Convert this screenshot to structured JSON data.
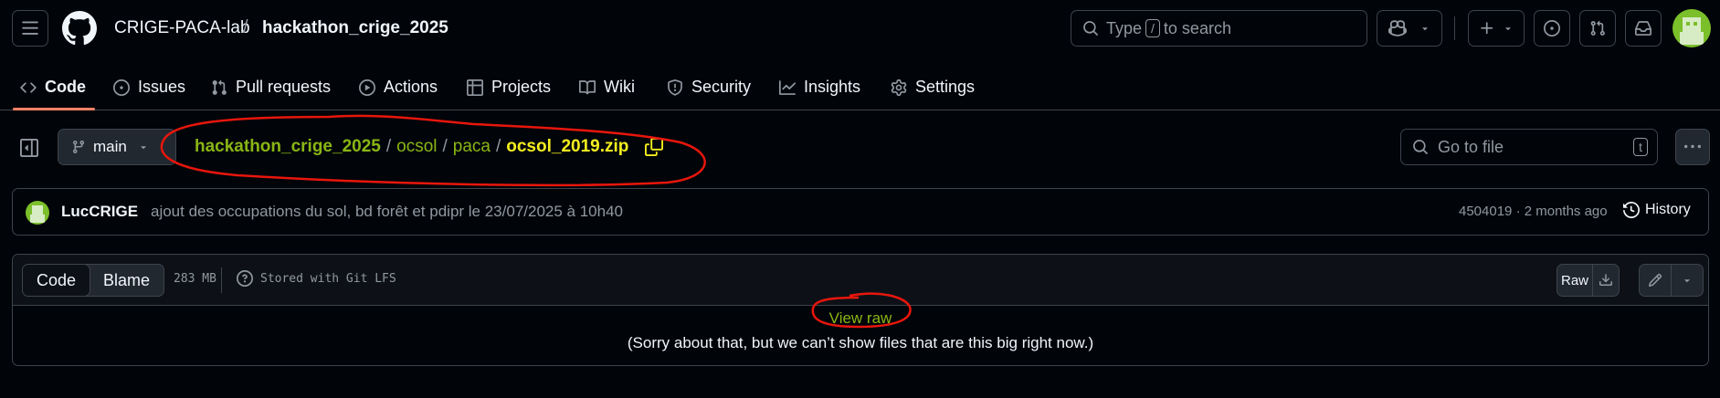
{
  "header": {
    "owner": "CRIGE-PACA-lab",
    "separator": "/",
    "repo": "hackathon_crige_2025",
    "search_prefix": "Type",
    "search_key": "/",
    "search_suffix": "to search"
  },
  "tabs": [
    {
      "label": "Code",
      "icon": "code-icon",
      "active": true
    },
    {
      "label": "Issues",
      "icon": "issue-icon"
    },
    {
      "label": "Pull requests",
      "icon": "pull-request-icon"
    },
    {
      "label": "Actions",
      "icon": "play-icon"
    },
    {
      "label": "Projects",
      "icon": "table-icon"
    },
    {
      "label": "Wiki",
      "icon": "book-icon"
    },
    {
      "label": "Security",
      "icon": "shield-icon"
    },
    {
      "label": "Insights",
      "icon": "graph-icon"
    },
    {
      "label": "Settings",
      "icon": "gear-icon"
    }
  ],
  "filebar": {
    "branch": "main",
    "breadcrumb": {
      "root": "hackathon_crige_2025",
      "sep": "/",
      "dir1": "ocsol",
      "dir2": "paca",
      "file": "ocsol_2019.zip"
    },
    "goto_placeholder": "Go to file",
    "goto_key": "t"
  },
  "commit": {
    "author": "LucCRIGE",
    "message": "ajout des occupations du sol, bd forêt et pdipr le 23/07/2025 à 10h40",
    "meta": "4504019 · 2 months ago",
    "history_label": "History"
  },
  "file": {
    "code_tab": "Code",
    "blame_tab": "Blame",
    "size": "283 MB",
    "lfs_label": "Stored with Git LFS",
    "raw_label": "Raw",
    "view_raw": "View raw",
    "sorry": "(Sorry about that, but we can’t show files that are this big right now.)"
  },
  "colors": {
    "background": "#010409",
    "border": "#3d444d",
    "link": "#8ab614",
    "annotation": "#e8160c",
    "active_tab_underline": "#f78166"
  }
}
